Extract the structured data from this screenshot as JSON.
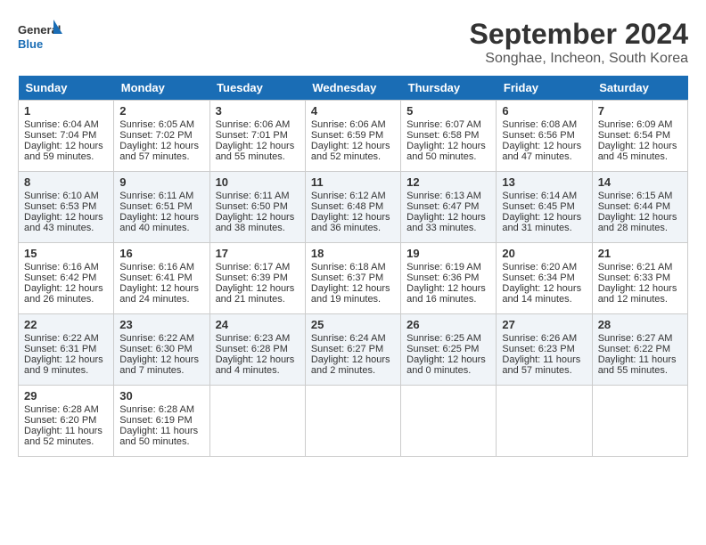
{
  "header": {
    "logo_line1": "General",
    "logo_line2": "Blue",
    "month_year": "September 2024",
    "location": "Songhae, Incheon, South Korea"
  },
  "weekdays": [
    "Sunday",
    "Monday",
    "Tuesday",
    "Wednesday",
    "Thursday",
    "Friday",
    "Saturday"
  ],
  "weeks": [
    [
      {
        "day": "1",
        "rise": "6:04 AM",
        "set": "7:04 PM",
        "daylight": "12 hours and 59 minutes."
      },
      {
        "day": "2",
        "rise": "6:05 AM",
        "set": "7:02 PM",
        "daylight": "12 hours and 57 minutes."
      },
      {
        "day": "3",
        "rise": "6:06 AM",
        "set": "7:01 PM",
        "daylight": "12 hours and 55 minutes."
      },
      {
        "day": "4",
        "rise": "6:06 AM",
        "set": "6:59 PM",
        "daylight": "12 hours and 52 minutes."
      },
      {
        "day": "5",
        "rise": "6:07 AM",
        "set": "6:58 PM",
        "daylight": "12 hours and 50 minutes."
      },
      {
        "day": "6",
        "rise": "6:08 AM",
        "set": "6:56 PM",
        "daylight": "12 hours and 47 minutes."
      },
      {
        "day": "7",
        "rise": "6:09 AM",
        "set": "6:54 PM",
        "daylight": "12 hours and 45 minutes."
      }
    ],
    [
      {
        "day": "8",
        "rise": "6:10 AM",
        "set": "6:53 PM",
        "daylight": "12 hours and 43 minutes."
      },
      {
        "day": "9",
        "rise": "6:11 AM",
        "set": "6:51 PM",
        "daylight": "12 hours and 40 minutes."
      },
      {
        "day": "10",
        "rise": "6:11 AM",
        "set": "6:50 PM",
        "daylight": "12 hours and 38 minutes."
      },
      {
        "day": "11",
        "rise": "6:12 AM",
        "set": "6:48 PM",
        "daylight": "12 hours and 36 minutes."
      },
      {
        "day": "12",
        "rise": "6:13 AM",
        "set": "6:47 PM",
        "daylight": "12 hours and 33 minutes."
      },
      {
        "day": "13",
        "rise": "6:14 AM",
        "set": "6:45 PM",
        "daylight": "12 hours and 31 minutes."
      },
      {
        "day": "14",
        "rise": "6:15 AM",
        "set": "6:44 PM",
        "daylight": "12 hours and 28 minutes."
      }
    ],
    [
      {
        "day": "15",
        "rise": "6:16 AM",
        "set": "6:42 PM",
        "daylight": "12 hours and 26 minutes."
      },
      {
        "day": "16",
        "rise": "6:16 AM",
        "set": "6:41 PM",
        "daylight": "12 hours and 24 minutes."
      },
      {
        "day": "17",
        "rise": "6:17 AM",
        "set": "6:39 PM",
        "daylight": "12 hours and 21 minutes."
      },
      {
        "day": "18",
        "rise": "6:18 AM",
        "set": "6:37 PM",
        "daylight": "12 hours and 19 minutes."
      },
      {
        "day": "19",
        "rise": "6:19 AM",
        "set": "6:36 PM",
        "daylight": "12 hours and 16 minutes."
      },
      {
        "day": "20",
        "rise": "6:20 AM",
        "set": "6:34 PM",
        "daylight": "12 hours and 14 minutes."
      },
      {
        "day": "21",
        "rise": "6:21 AM",
        "set": "6:33 PM",
        "daylight": "12 hours and 12 minutes."
      }
    ],
    [
      {
        "day": "22",
        "rise": "6:22 AM",
        "set": "6:31 PM",
        "daylight": "12 hours and 9 minutes."
      },
      {
        "day": "23",
        "rise": "6:22 AM",
        "set": "6:30 PM",
        "daylight": "12 hours and 7 minutes."
      },
      {
        "day": "24",
        "rise": "6:23 AM",
        "set": "6:28 PM",
        "daylight": "12 hours and 4 minutes."
      },
      {
        "day": "25",
        "rise": "6:24 AM",
        "set": "6:27 PM",
        "daylight": "12 hours and 2 minutes."
      },
      {
        "day": "26",
        "rise": "6:25 AM",
        "set": "6:25 PM",
        "daylight": "12 hours and 0 minutes."
      },
      {
        "day": "27",
        "rise": "6:26 AM",
        "set": "6:23 PM",
        "daylight": "11 hours and 57 minutes."
      },
      {
        "day": "28",
        "rise": "6:27 AM",
        "set": "6:22 PM",
        "daylight": "11 hours and 55 minutes."
      }
    ],
    [
      {
        "day": "29",
        "rise": "6:28 AM",
        "set": "6:20 PM",
        "daylight": "11 hours and 52 minutes."
      },
      {
        "day": "30",
        "rise": "6:28 AM",
        "set": "6:19 PM",
        "daylight": "11 hours and 50 minutes."
      },
      null,
      null,
      null,
      null,
      null
    ]
  ]
}
